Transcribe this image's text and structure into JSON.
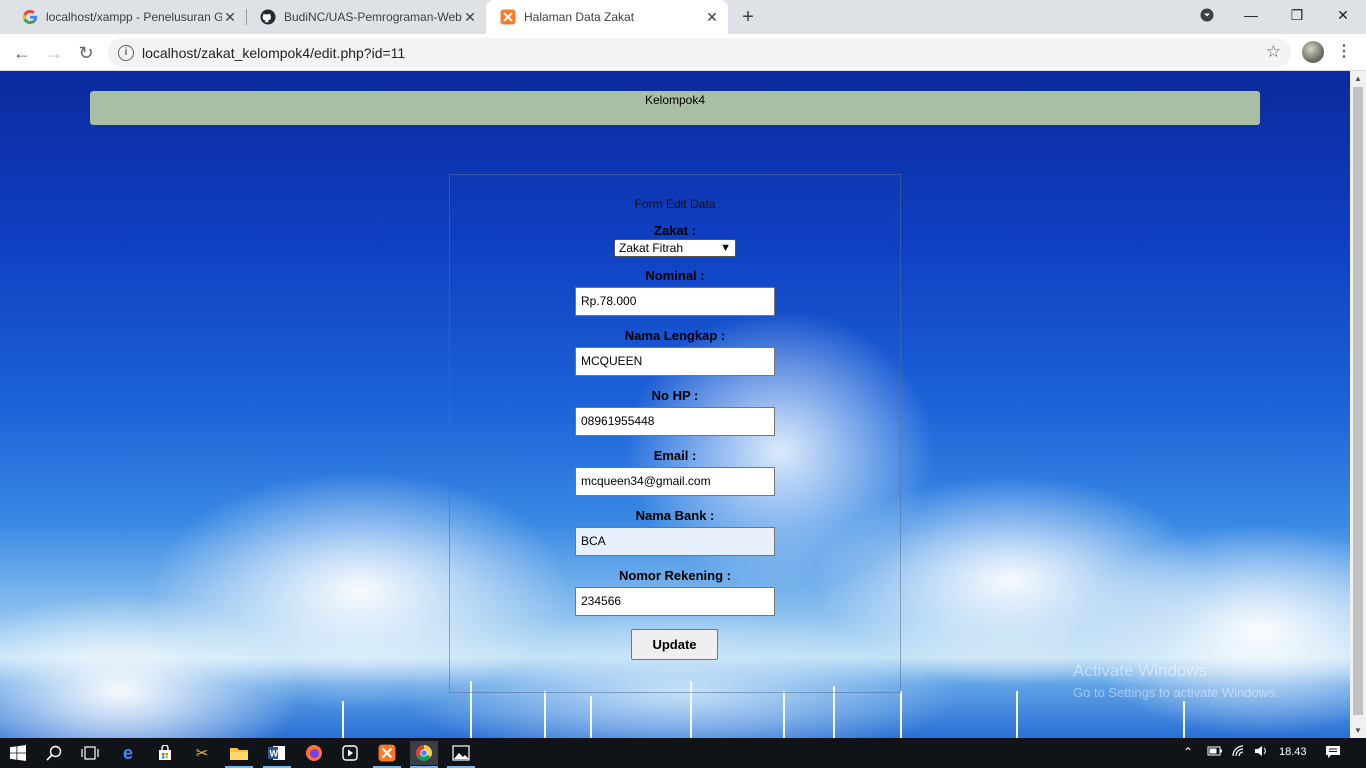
{
  "browser": {
    "tabs": [
      {
        "title": "localhost/xampp - Penelusuran G",
        "favicon": "google-icon"
      },
      {
        "title": "BudiNC/UAS-Pemrograman-Web",
        "favicon": "github-icon"
      },
      {
        "title": "Halaman Data Zakat",
        "favicon": "xampp-icon"
      }
    ],
    "url": "localhost/zakat_kelompok4/edit.php?id=11"
  },
  "page": {
    "header": "Kelompok4",
    "form_title": "Form Edit Data",
    "fields": {
      "zakat": {
        "label": "Zakat :",
        "value": "Zakat Fitrah"
      },
      "nominal": {
        "label": "Nominal :",
        "value": "Rp.78.000"
      },
      "nama": {
        "label": "Nama Lengkap :",
        "value": "MCQUEEN"
      },
      "hp": {
        "label": "No HP :",
        "value": "08961955448"
      },
      "email": {
        "label": "Email :",
        "value": "mcqueen34@gmail.com"
      },
      "bank": {
        "label": "Nama Bank :",
        "value": "BCA"
      },
      "rekening": {
        "label": "Nomor Rekening :",
        "value": "234566"
      }
    },
    "submit_label": "Update"
  },
  "watermark": {
    "line1": "Activate Windows",
    "line2": "Go to Settings to activate Windows."
  },
  "taskbar": {
    "clock": "18.43"
  }
}
